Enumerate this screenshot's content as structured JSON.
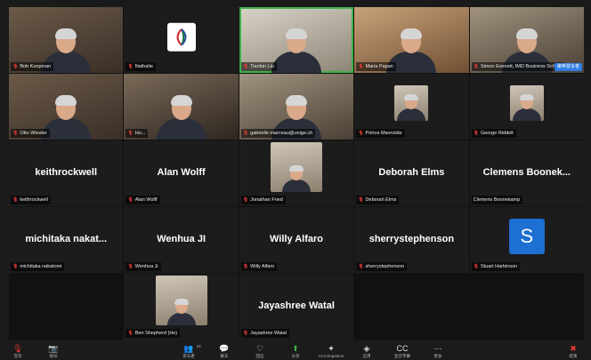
{
  "participants": [
    {
      "name": "Bob Koopman",
      "type": "video",
      "style": "v1"
    },
    {
      "name": "Nathalie",
      "type": "logo"
    },
    {
      "name": "Tianbin Liu",
      "type": "video",
      "style": "v2",
      "active": true
    },
    {
      "name": "Maria Pagan",
      "type": "video",
      "style": "v3"
    },
    {
      "name": "Simon Evenett, IMD Business School",
      "type": "video",
      "style": "v4",
      "chip": "聚焦發言者"
    },
    {
      "name": "Otto Wiesler",
      "type": "video",
      "style": "v1"
    },
    {
      "name": "Hu...",
      "type": "video",
      "style": "v5"
    },
    {
      "name": "gabrielle.marceau@unige.ch",
      "type": "video",
      "style": "v4"
    },
    {
      "name": "Petros Mavroidis",
      "type": "thumb"
    },
    {
      "name": "George Riddell",
      "type": "thumb"
    },
    {
      "name": "keithrockwell",
      "type": "name",
      "display": "keithrockwell"
    },
    {
      "name": "Alan Wolff",
      "type": "name",
      "display": "Alan Wolff"
    },
    {
      "name": "Jonathan Fried",
      "type": "thumb-big"
    },
    {
      "name": "Deborah Elms",
      "type": "name",
      "display": "Deborah Elms"
    },
    {
      "name": "Clemens Boonekamp",
      "type": "name",
      "display": "Clemens  Boonek...",
      "muted": false
    },
    {
      "name": "michitaka nakatomi",
      "type": "name",
      "display": "michitaka  nakat..."
    },
    {
      "name": "Wenhua Ji",
      "type": "name",
      "display": "Wenhua JI"
    },
    {
      "name": "Willy Alfaro",
      "type": "name",
      "display": "Willy Alfaro"
    },
    {
      "name": "sherrystephenson",
      "type": "name",
      "display": "sherrystephenson"
    },
    {
      "name": "Stuart Harbinson",
      "type": "avatar",
      "letter": "S"
    },
    {
      "name": "Ben Shepherd (He)",
      "type": "thumb-big",
      "col": 2
    },
    {
      "name": "Jayashree Watal",
      "type": "name",
      "display": "Jayashree Watal"
    }
  ],
  "toolbar": {
    "left": [
      {
        "icon": "microphone-muted-icon",
        "glyph": "🎙",
        "label": "音讯",
        "red": true
      },
      {
        "icon": "video-camera-off-icon",
        "glyph": "📷",
        "label": "视讯",
        "red": true
      }
    ],
    "center": [
      {
        "icon": "participants-icon",
        "glyph": "👥",
        "label": "参与者",
        "count": "22"
      },
      {
        "icon": "chat-icon",
        "glyph": "💬",
        "label": "聊天"
      },
      {
        "icon": "reactions-icon",
        "glyph": "♡",
        "label": "回应"
      },
      {
        "icon": "share-screen-icon",
        "glyph": "⬆",
        "label": "分享",
        "green": true
      },
      {
        "icon": "ai-companion-icon",
        "glyph": "✦",
        "label": "AI Companion"
      },
      {
        "icon": "apps-icon",
        "glyph": "◈",
        "label": "应用"
      },
      {
        "icon": "captions-icon",
        "glyph": "CC",
        "label": "显示字幕"
      },
      {
        "icon": "more-icon",
        "glyph": "⋯",
        "label": "更多"
      }
    ],
    "right": [
      {
        "icon": "leave-icon",
        "glyph": "✖",
        "label": "结束",
        "red": true
      }
    ]
  }
}
